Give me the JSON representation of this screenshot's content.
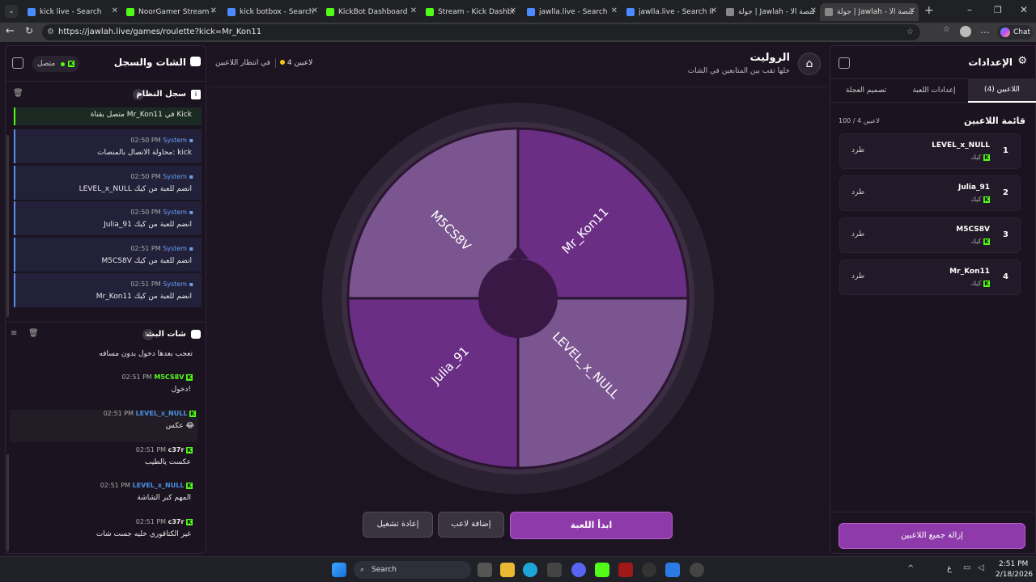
{
  "tabs": [
    {
      "label": "kick live - Search",
      "color": "#4a8cff"
    },
    {
      "label": "NoorGamer Stream - W",
      "color": "#53fc18"
    },
    {
      "label": "kick botbox - Search",
      "color": "#4a8cff"
    },
    {
      "label": "KickBot Dashboard",
      "color": "#53fc18"
    },
    {
      "label": "Stream - Kick Dashboar",
      "color": "#53fc18"
    },
    {
      "label": "jawlla.live - Search",
      "color": "#4a8cff"
    },
    {
      "label": "jawlla.live - Search Imag",
      "color": "#4a8cff"
    },
    {
      "label": "جولة | Jawlah - منصة الأ",
      "color": "#888"
    },
    {
      "label": "جولة | Jawlah - منصة الأ",
      "color": "#888"
    }
  ],
  "browser": {
    "url": "https://jawlah.live/games/roulette?kick=Mr_Kon11",
    "chat_label": "Chat"
  },
  "left": {
    "title": "الشات والسجل",
    "status": "متصل",
    "system_log": {
      "title": "سجل النظام",
      "count": "6",
      "first_line": "متصل بقناة Mr_Kon11 في Kick"
    },
    "messages": [
      {
        "sender": "System",
        "time": "02:50 PM",
        "text": "محاولة الاتصال بالمنصات: kick"
      },
      {
        "sender": "System",
        "time": "02:50 PM",
        "text": "LEVEL_x_NULL انضم للعبة من كيك"
      },
      {
        "sender": "System",
        "time": "02:50 PM",
        "text": "Julia_91 انضم للعبة من كيك"
      },
      {
        "sender": "System",
        "time": "02:51 PM",
        "text": "M5CS8V انضم للعبة من كيك"
      },
      {
        "sender": "System",
        "time": "02:51 PM",
        "text": "Mr_Kon11 انضم للعبة من كيك"
      }
    ],
    "stream_chat": {
      "title": "شات البث",
      "count": "11",
      "first_line": "تعجب بعدها دخول بدون مسافه"
    },
    "chat": [
      {
        "user": "M5CS8V",
        "time": "02:51 PM",
        "text": "دخول!",
        "color": "#53fc18"
      },
      {
        "user": "LEVEL_x_NULL",
        "time": "02:51 PM",
        "text": "عكس 😂",
        "color": "#4a90e2"
      },
      {
        "user": "c37r",
        "time": "02:51 PM",
        "text": "عكست يالطيب",
        "color": "#e8e8e8"
      },
      {
        "user": "LEVEL_x_NULL",
        "time": "02:51 PM",
        "text": "المهم كبر الشاشة",
        "color": "#4a90e2"
      },
      {
        "user": "c37r",
        "time": "02:51 PM",
        "text": "غير الكتاقوري خليه جست شات",
        "color": "#e8e8e8"
      }
    ]
  },
  "center": {
    "title": "الروليت",
    "subtitle": "خلها تقب بين المتابعين في الشات",
    "players_status": "4 لاعبين",
    "waiting": "في انتظار اللاعبين",
    "segments": [
      "Mr_Kon11",
      "LEVEL_x_NULL",
      "Julia_91",
      "M5CS8V"
    ],
    "start": "ابدأ اللعبة",
    "add_player": "إضافة لاعب",
    "restart": "إعادة تشغيل"
  },
  "right": {
    "title": "الإعدادات",
    "tabs": [
      "اللاعبين (4)",
      "إعدادات اللعبة",
      "تصميم العجلة"
    ],
    "list_title": "قائمة اللاعبين",
    "list_count": "100 / 4 لاعبين",
    "players": [
      {
        "rank": "1",
        "name": "LEVEL_x_NULL",
        "platform": "كيك",
        "action": "طرد"
      },
      {
        "rank": "2",
        "name": "Julia_91",
        "platform": "كيك",
        "action": "طرد"
      },
      {
        "rank": "3",
        "name": "M5CS8V",
        "platform": "كيك",
        "action": "طرد"
      },
      {
        "rank": "4",
        "name": "Mr_Kon11",
        "platform": "كيك",
        "action": "طرد"
      }
    ],
    "remove_all": "إزالة جميع اللاعبين"
  },
  "taskbar": {
    "search": "Search",
    "time": "2:51 PM",
    "date": "2/18/2026",
    "lang": "ع"
  }
}
